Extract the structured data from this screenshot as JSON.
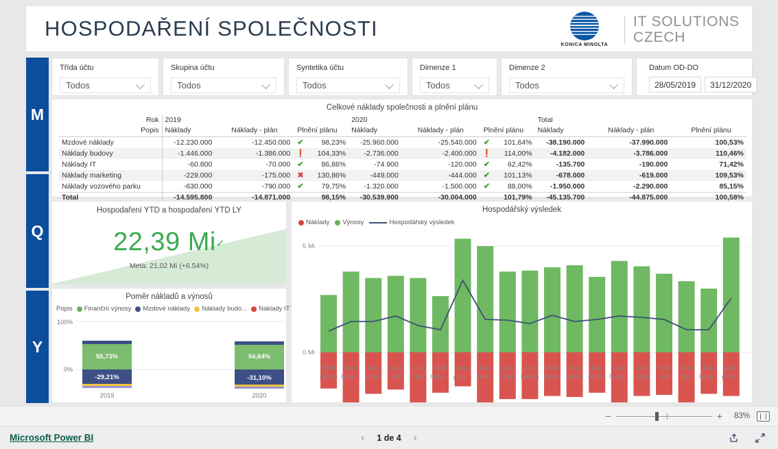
{
  "header": {
    "title": "HOSPODAŘENÍ SPOLEČNOSTI",
    "brand_mark": "konica-minolta-logo",
    "brand_word": "KONICA MINOLTA",
    "brand_line1": "IT SOLUTIONS",
    "brand_line2": "CZECH"
  },
  "rail": {
    "buttons": [
      {
        "label": "M",
        "name": "monthly"
      },
      {
        "label": "Q",
        "name": "quarterly"
      },
      {
        "label": "Y",
        "name": "yearly"
      }
    ],
    "color": "#0d4e9c"
  },
  "filters": {
    "slicers": [
      {
        "label": "Třída účtu",
        "value": "Todos"
      },
      {
        "label": "Skupina účtu",
        "value": "Todos"
      },
      {
        "label": "Syntetika účtu",
        "value": "Todos"
      },
      {
        "label": "Dimenze 1",
        "value": "Todos"
      },
      {
        "label": "Dimenze 2",
        "value": "Todos"
      }
    ],
    "date": {
      "label": "Datum OD-DO",
      "from": "28/05/2019",
      "to": "31/12/2020"
    }
  },
  "matrix": {
    "title": "Celkové náklady společnosti a plnění plánu",
    "row_header_top": "Rok",
    "row_header_bottom": "Popis",
    "groups": [
      {
        "name": "2019",
        "bold": false
      },
      {
        "name": "2020",
        "bold": false
      },
      {
        "name": "Total",
        "bold": true
      }
    ],
    "sub_headers": [
      "Náklady",
      "Náklady - plán",
      "Plnění plánu"
    ],
    "rows": [
      {
        "label": "Mzdové náklady",
        "y2019": {
          "naklady": "-12.230.000",
          "plan": "-12.450.000",
          "status": "ok",
          "pct": "98,23%"
        },
        "y2020": {
          "naklady": "-25.960.000",
          "plan": "-25.540.000",
          "status": "ok",
          "pct": "101,64%"
        },
        "total": {
          "naklady": "-38.190.000",
          "plan": "-37.990.000",
          "pct": "100,53%"
        }
      },
      {
        "label": "Náklady budovy",
        "y2019": {
          "naklady": "-1.446.000",
          "plan": "-1.386.000",
          "status": "warn",
          "pct": "104,33%"
        },
        "y2020": {
          "naklady": "-2.736.000",
          "plan": "-2.400.000",
          "status": "warn",
          "pct": "114,00%"
        },
        "total": {
          "naklady": "-4.182.000",
          "plan": "-3.786.000",
          "pct": "110,46%"
        }
      },
      {
        "label": "Náklady IT",
        "y2019": {
          "naklady": "-60.800",
          "plan": "-70.000",
          "status": "ok",
          "pct": "86,86%"
        },
        "y2020": {
          "naklady": "-74.900",
          "plan": "-120.000",
          "status": "ok",
          "pct": "62,42%"
        },
        "total": {
          "naklady": "-135.700",
          "plan": "-190.000",
          "pct": "71,42%"
        }
      },
      {
        "label": "Náklady marketing",
        "y2019": {
          "naklady": "-229.000",
          "plan": "-175.000",
          "status": "bad",
          "pct": "130,86%"
        },
        "y2020": {
          "naklady": "-449.000",
          "plan": "-444.000",
          "status": "ok",
          "pct": "101,13%"
        },
        "total": {
          "naklady": "-678.000",
          "plan": "-619.000",
          "pct": "109,53%"
        }
      },
      {
        "label": "Náklady vozového parku",
        "y2019": {
          "naklady": "-630.000",
          "plan": "-790.000",
          "status": "ok",
          "pct": "79,75%"
        },
        "y2020": {
          "naklady": "-1.320.000",
          "plan": "-1.500.000",
          "status": "ok",
          "pct": "88,00%"
        },
        "total": {
          "naklady": "-1.950.000",
          "plan": "-2.290.000",
          "pct": "85,15%"
        }
      }
    ],
    "total_row": {
      "label": "Total",
      "y2019": {
        "naklady": "-14.595.800",
        "plan": "-14.871.000",
        "status": "",
        "pct": "98,15%"
      },
      "y2020": {
        "naklady": "-30.539.900",
        "plan": "-30.004.000",
        "status": "",
        "pct": "101,79%"
      },
      "total": {
        "naklady": "-45.135.700",
        "plan": "-44.875.000",
        "pct": "100,58%"
      }
    },
    "status_icons": {
      "ok": "check-icon",
      "warn": "exclamation-icon",
      "bad": "cross-icon"
    }
  },
  "kpi": {
    "title": "Hospodaření YTD a hospodaření YTD LY",
    "value": "22,39 Mi",
    "trend_icon": "check-icon",
    "goal_text": "Meta: 21,02 Mi (+6.54%)",
    "color": "#3aab4e"
  },
  "ratio_chart": {
    "title": "Poměr nákladů a výnosů",
    "legend_label": "Popis",
    "legend": [
      {
        "label": "Finanční výnosy",
        "color": "#68b25b"
      },
      {
        "label": "Mzdové náklady",
        "color": "#3d4f85"
      },
      {
        "label": "Náklady budo...",
        "color": "#f2c43d"
      },
      {
        "label": "Náklady IT",
        "color": "#d9453f"
      }
    ],
    "legend_overflow_icon": "chevron-right-icon",
    "chart_data": {
      "type": "bar",
      "title": "Poměr nákladů a výnosů",
      "categories": [
        "2019",
        "2020"
      ],
      "ylabels": [
        "100%",
        "0%"
      ],
      "ylim": [
        -40,
        100
      ],
      "grid": true,
      "legend_position": "top",
      "series": [
        {
          "name": "Finanční výnosy",
          "color": "#68b25b",
          "values": [
            55.73,
            54.64
          ],
          "labels": [
            "55,73%",
            "54,64%"
          ]
        },
        {
          "name": "Mzdové náklady",
          "color": "#3d4f85",
          "values": [
            -29.21,
            -31.1
          ],
          "labels": [
            "-29,21%",
            "-31,10%"
          ]
        },
        {
          "name": "Náklady budo...",
          "color": "#f2c43d",
          "values": [
            -2.1,
            -2.4
          ],
          "labels": [
            "",
            ""
          ]
        },
        {
          "name": "Náklady IT",
          "color": "#9b8fd4",
          "values": [
            -1.2,
            -1.4
          ],
          "labels": [
            "",
            ""
          ]
        }
      ]
    }
  },
  "combo_chart": {
    "title": "Hospodářský výsledek",
    "legend": [
      {
        "label": "Náklady",
        "color": "#d9453f",
        "marker": "dot"
      },
      {
        "label": "Výnosy",
        "color": "#68b25b",
        "marker": "dot"
      },
      {
        "label": "Hospodářský výsledek",
        "color": "#3f4f77",
        "marker": "line"
      }
    ],
    "chart_data": {
      "type": "bar",
      "title": "Hospodářský výsledek",
      "xlabel": "",
      "ylabel": "",
      "ylim": [
        -3.2,
        6.0
      ],
      "yticks": [
        0,
        5
      ],
      "yticklabels": [
        "0 Mi",
        "5 Mi"
      ],
      "grid": true,
      "legend_position": "top-left",
      "categories": [
        "2019 červen",
        "2019 červe…",
        "2019 srpen",
        "2019 září",
        "2019 říjen",
        "2019 listop…",
        "2019 prosi…",
        "2020 leden",
        "2020 únor",
        "2020 březen",
        "2020 duben",
        "2020 květen",
        "2020 červen",
        "2020 červe…",
        "2020 srpen",
        "2020 září",
        "2020 říjen",
        "2020 listop…",
        "2020 prosi…"
      ],
      "category_years": [
        "2019",
        "2019",
        "2019",
        "2019",
        "2019",
        "2019",
        "2019",
        "2020",
        "2020",
        "2020",
        "2020",
        "2020",
        "2020",
        "2020",
        "2020",
        "2020",
        "2020",
        "2020",
        "2020"
      ],
      "category_months": [
        "červen",
        "červe…",
        "srpen",
        "září",
        "říjen",
        "listop…",
        "prosi…",
        "leden",
        "únor",
        "březen",
        "duben",
        "květen",
        "červen",
        "červe…",
        "srpen",
        "září",
        "říjen",
        "listop…",
        "prosi…"
      ],
      "series": [
        {
          "name": "Výnosy",
          "color": "#68b25b",
          "values": [
            2.7,
            3.8,
            3.5,
            3.6,
            3.5,
            2.65,
            5.35,
            5.0,
            3.8,
            3.85,
            4.0,
            4.1,
            3.55,
            4.3,
            4.05,
            3.7,
            3.35,
            3.0,
            5.4
          ]
        },
        {
          "name": "Náklady",
          "color": "#d9453f",
          "values": [
            -1.7,
            -2.55,
            -1.95,
            -1.75,
            -2.45,
            -1.9,
            -1.6,
            -3.1,
            -2.2,
            -2.2,
            -2.05,
            -2.1,
            -1.9,
            -2.7,
            -2.05,
            -2.0,
            -2.6,
            -1.95,
            -2.05
          ]
        }
      ],
      "line_series": {
        "name": "Hospodářský výsledek",
        "color": "#3f4f77",
        "values": [
          1.0,
          1.45,
          1.45,
          1.7,
          1.25,
          1.05,
          3.4,
          1.55,
          1.5,
          1.35,
          1.75,
          1.45,
          1.55,
          1.7,
          1.65,
          1.55,
          1.05,
          1.05,
          2.55
        ]
      }
    }
  },
  "statusbar": {
    "zoom_out_icon": "minus-icon",
    "zoom_in_icon": "plus-icon",
    "zoom_level": "83%",
    "fit_icon": "fit-to-page-icon"
  },
  "footer": {
    "brand_link": "Microsoft Power BI",
    "prev_icon": "chevron-left-icon",
    "next_icon": "chevron-right-icon",
    "page_label": "1 de 4",
    "share_icon": "share-icon",
    "fullscreen_icon": "fullscreen-icon"
  }
}
